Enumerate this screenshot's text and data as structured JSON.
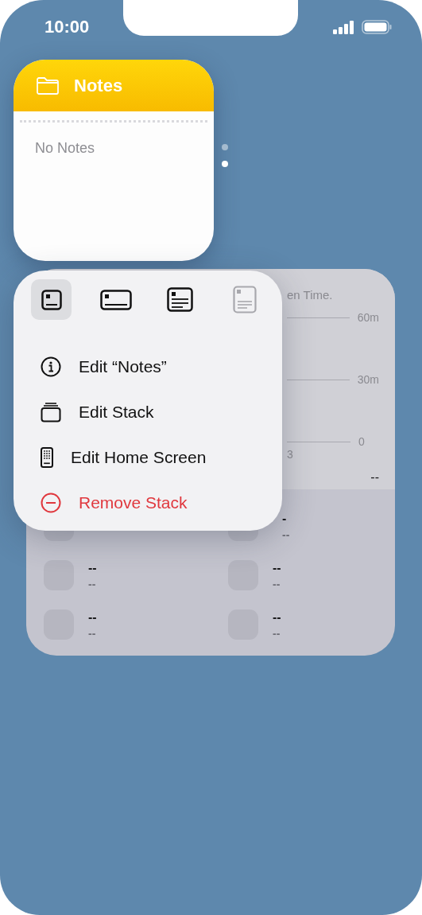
{
  "status_bar": {
    "time": "10:00"
  },
  "notes_widget": {
    "title": "Notes",
    "empty_text": "No Notes"
  },
  "stack_pages": [
    {
      "selected": false
    },
    {
      "selected": true
    }
  ],
  "background_widget": {
    "caption": "en Time.",
    "axis_labels": [
      "60m",
      "30m",
      "0"
    ],
    "x_label": "3",
    "total": "--",
    "apps": [
      {
        "kind": "placeholder"
      },
      {
        "kind": "placeholder",
        "title": "-",
        "subtitle": "--"
      },
      {
        "kind": "placeholder",
        "title": "--",
        "subtitle": "--"
      },
      {
        "kind": "placeholder",
        "title": "--",
        "subtitle": "--"
      },
      {
        "kind": "placeholder",
        "title": "--",
        "subtitle": "--"
      },
      {
        "kind": "placeholder",
        "title": "--",
        "subtitle": "--"
      }
    ]
  },
  "context_menu": {
    "sizes": [
      {
        "kind": "small",
        "selected": true,
        "disabled": false
      },
      {
        "kind": "medium",
        "selected": false,
        "disabled": false
      },
      {
        "kind": "large",
        "selected": false,
        "disabled": false
      },
      {
        "kind": "xlarge",
        "selected": false,
        "disabled": true
      }
    ],
    "actions": [
      {
        "kind": "info",
        "label": "Edit “Notes”",
        "destructive": false
      },
      {
        "kind": "stack",
        "label": "Edit Stack",
        "destructive": false
      },
      {
        "kind": "home",
        "label": "Edit Home Screen",
        "destructive": false
      },
      {
        "kind": "remove",
        "label": "Remove Stack",
        "destructive": true
      }
    ]
  }
}
